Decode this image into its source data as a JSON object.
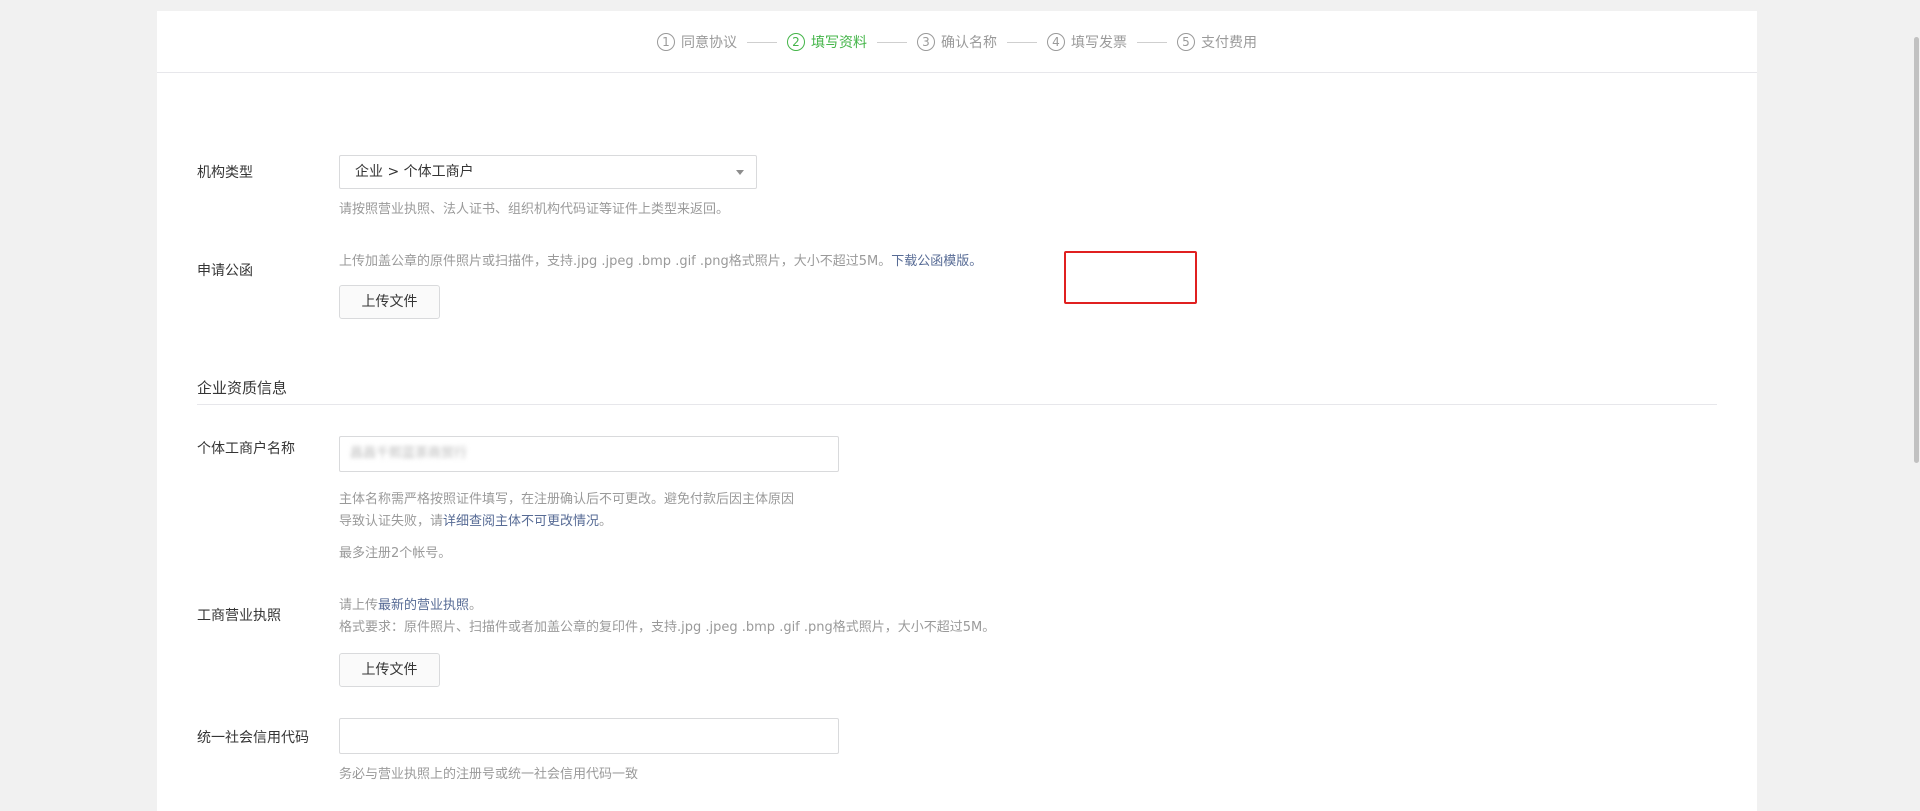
{
  "steps": [
    {
      "num": "1",
      "label": "同意协议",
      "active": false
    },
    {
      "num": "2",
      "label": "填写资料",
      "active": true
    },
    {
      "num": "3",
      "label": "确认名称",
      "active": false
    },
    {
      "num": "4",
      "label": "填写发票",
      "active": false
    },
    {
      "num": "5",
      "label": "支付费用",
      "active": false
    }
  ],
  "org_type": {
    "label": "机构类型",
    "value": "企业 > 个体工商户",
    "tip": "请按照营业执照、法人证书、组织机构代码证等证件上类型来返回。"
  },
  "letter": {
    "label": "申请公函",
    "tip": "上传加盖公章的原件照片或扫描件，支持.jpg .jpeg .bmp .gif .png格式照片，大小不超过5M。",
    "download_link": "下载公函模版。",
    "upload_button": "上传文件"
  },
  "qualification_section": {
    "title": "企业资质信息"
  },
  "business_name": {
    "label": "个体工商户名称",
    "value": "昌昌千熙蓝茶商贸行",
    "tip_line1": "主体名称需严格按照证件填写，在注册确认后不可更改。避免付款后因主体原因",
    "tip_line2_prefix": "导致认证失败，请",
    "tip_line2_link": "详细查阅主体不可更改情况",
    "tip_line2_suffix": "。",
    "limit_tip": "最多注册2个帐号。"
  },
  "license": {
    "label": "工商营业执照",
    "tip1_prefix": "请上传",
    "tip1_link": "最新的营业执照",
    "tip1_suffix": "。",
    "tip2": "格式要求：原件照片、扫描件或者加盖公章的复印件，支持.jpg .jpeg .bmp .gif .png格式照片，大小不超过5M。",
    "upload_button": "上传文件"
  },
  "credit_code": {
    "label": "统一社会信用代码",
    "value": "",
    "tip": "务必与营业执照上的注册号或统一社会信用代码一致"
  },
  "colors": {
    "active_step": "#44b549",
    "link": "#576b95",
    "highlight": "#e02020"
  }
}
